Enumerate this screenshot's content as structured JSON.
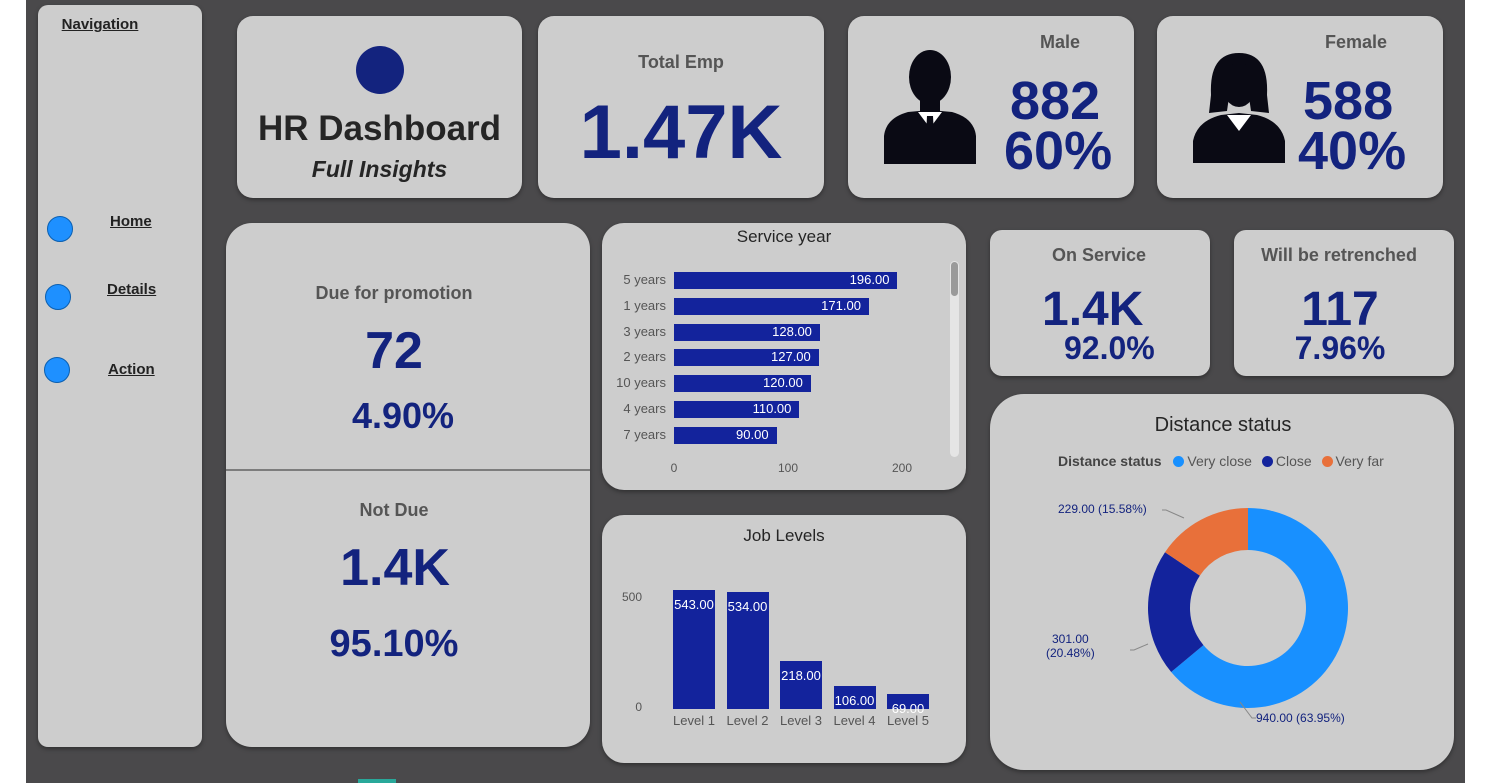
{
  "navigation": {
    "title": "Navigation",
    "links": [
      {
        "label": "Home"
      },
      {
        "label": "Details"
      },
      {
        "label": "Action"
      }
    ]
  },
  "header": {
    "title": "HR Dashboard",
    "subtitle": "Full Insights"
  },
  "total_emp": {
    "label": "Total Emp",
    "value": "1.47K"
  },
  "male": {
    "label": "Male",
    "count": "882",
    "pct": "60%"
  },
  "female": {
    "label": "Female",
    "count": "588",
    "pct": "40%"
  },
  "promotion": {
    "due_label": "Due for promotion",
    "due_value": "72",
    "due_pct": "4.90%",
    "not_due_label": "Not Due",
    "not_due_value": "1.4K",
    "not_due_pct": "95.10%"
  },
  "on_service": {
    "label": "On Service",
    "value": "1.4K",
    "pct": "92.0%"
  },
  "retrenched": {
    "label": "Will be retrenched",
    "value": "117",
    "pct": "7.96%"
  },
  "colors": {
    "accent_navy": "#13237e",
    "bar_blue": "#13239c",
    "very_close": "#1890ff",
    "close": "#13239c",
    "very_far": "#e8703a",
    "card_bg": "#cdcdcd",
    "canvas_bg": "#4a494b"
  },
  "icons": [
    "male-silhouette-icon",
    "female-silhouette-icon",
    "logo-circle-icon"
  ],
  "chart_data": [
    {
      "type": "bar",
      "orientation": "horizontal",
      "title": "Service year",
      "categories": [
        "5 years",
        "1 years",
        "3 years",
        "2 years",
        "10 years",
        "4 years",
        "7 years"
      ],
      "values": [
        196.0,
        171.0,
        128.0,
        127.0,
        120.0,
        110.0,
        90.0
      ],
      "value_labels": [
        "196.00",
        "171.00",
        "128.00",
        "127.00",
        "120.00",
        "110.00",
        "90.00"
      ],
      "x_ticks": [
        "0",
        "100",
        "200"
      ],
      "xlim": [
        0,
        200
      ]
    },
    {
      "type": "bar",
      "title": "Job Levels",
      "categories": [
        "Level 1",
        "Level 2",
        "Level 3",
        "Level 4",
        "Level 5"
      ],
      "values": [
        543.0,
        534.0,
        218.0,
        106.0,
        69.0
      ],
      "value_labels": [
        "543.00",
        "534.00",
        "218.00",
        "106.00",
        "69.00"
      ],
      "y_ticks": [
        "500",
        "0"
      ],
      "ylim": [
        0,
        560
      ]
    },
    {
      "type": "pie",
      "donut": true,
      "title": "Distance status",
      "legend_title": "Distance status",
      "legend": [
        "Very close",
        "Close",
        "Very far"
      ],
      "values": [
        940.0,
        301.0,
        229.0
      ],
      "labels": [
        "940.00 (63.95%)",
        "301.00 (20.48%)",
        "229.00 (15.58%)"
      ],
      "label_lines": [
        [
          "940.00 (63.95%)"
        ],
        [
          "301.00",
          "(20.48%)"
        ],
        [
          "229.00 (15.58%)"
        ]
      ]
    }
  ]
}
